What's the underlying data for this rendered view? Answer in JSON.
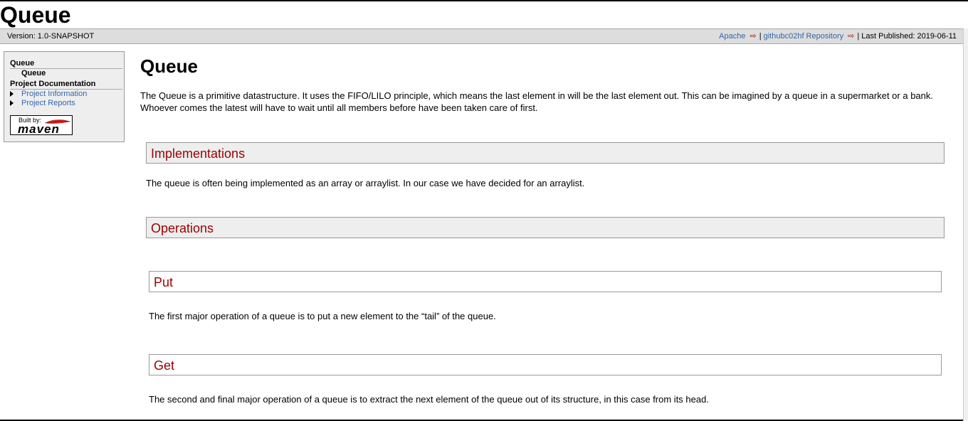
{
  "banner": {
    "title": "Queue"
  },
  "breadcrumbs": {
    "version": "Version: 1.0-SNAPSHOT",
    "links": [
      {
        "label": "Apache"
      },
      {
        "label": "githubc02hf Repository"
      }
    ],
    "separator": "|",
    "last_published": "| Last Published: 2019-06-11"
  },
  "sidebar": {
    "group1_title": "Queue",
    "group1_item": "Queue",
    "group2_title": "Project Documentation",
    "items": [
      {
        "label": "Project Information"
      },
      {
        "label": "Project Reports"
      }
    ],
    "powered_by": {
      "built_by": "Built by:",
      "brand": "maven"
    }
  },
  "main": {
    "title": "Queue",
    "intro": "The Queue is a primitive datastructure. It uses the FIFO/LILO principle, which means the last element in will be the last element out. This can be imagined by a queue in a supermarket or a bank. Whoever comes the latest will have to wait until all members before have been taken care of first.",
    "sections": [
      {
        "title": "Implementations",
        "text": "The queue is often being implemented as an array or arraylist. In our case we have decided for an arraylist."
      },
      {
        "title": "Operations"
      }
    ],
    "subsections": [
      {
        "title": "Put",
        "text": "The first major operation of a queue is to put a new element to the “tail” of the queue."
      },
      {
        "title": "Get",
        "text": "The second and final major operation of a queue is to extract the next element of the queue out of its structure, in this case from its head."
      }
    ]
  },
  "colors": {
    "accent": "#990000",
    "link": "#3366aa",
    "header_bg": "#eeeeee"
  }
}
